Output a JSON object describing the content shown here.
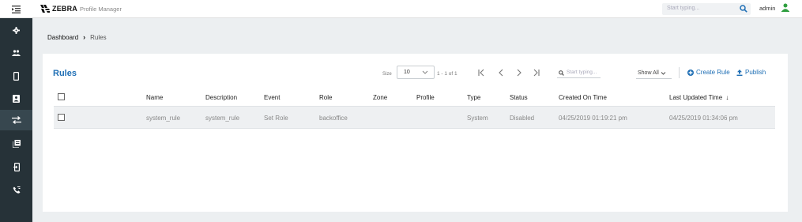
{
  "app": {
    "brand": "ZEBRA",
    "product": "Profile Manager"
  },
  "topbar": {
    "search_placeholder": "Start typing...",
    "user": "admin"
  },
  "icons": {
    "menu": "menu-collapse-icon",
    "search": "search-icon",
    "user": "person-icon",
    "sidebar": [
      "gear-icon",
      "group-icon",
      "device-icon",
      "badge-icon",
      "rules-icon",
      "copy-icon",
      "device-login-icon",
      "phone-icon"
    ]
  },
  "colors": {
    "accent": "#1f6fb5",
    "sidebar": "#263238",
    "user_icon": "#2e9e3f"
  },
  "breadcrumb": {
    "home": "Dashboard",
    "current": "Rules"
  },
  "card": {
    "title": "Rules",
    "size_label": "Size",
    "size_value": "10",
    "range": "1 - 1 of 1",
    "search_placeholder": "Start typing...",
    "filter": "Show All",
    "create_label": "Create Rule",
    "publish_label": "Publish"
  },
  "table": {
    "columns": [
      "Name",
      "Description",
      "Event",
      "Role",
      "Zone",
      "Profile",
      "Type",
      "Status",
      "Created On Time",
      "Last Updated Time"
    ],
    "sort_indicator": "↓",
    "rows": [
      [
        "system_rule",
        "system_rule",
        "Set Role",
        "backoffice",
        "",
        "",
        "System",
        "Disabled",
        "04/25/2019 01:19:21 pm",
        "04/25/2019 01:34:06 pm"
      ]
    ]
  }
}
